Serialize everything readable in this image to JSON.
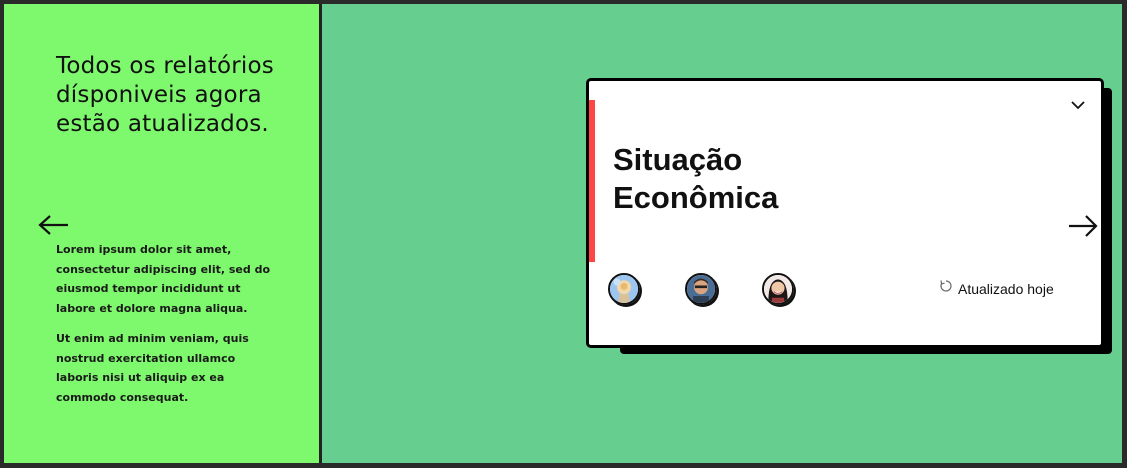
{
  "left": {
    "headline": "Todos os relatórios dísponiveis agora estão atualizados.",
    "paragraphs": [
      "Lorem ipsum dolor sit amet, consectetur adipiscing elit, sed do eiusmod tempor incididunt ut labore et dolore magna aliqua.",
      "Ut enim ad minim veniam, quis nostrud exercitation ullamco laboris nisi ut aliquip ex ea commodo consequat."
    ]
  },
  "card": {
    "title": "Situação Econômica",
    "status": "Atualizado hoje",
    "accent_color": "#ff4545"
  },
  "colors": {
    "left_panel": "#7ef86c",
    "right_panel": "#66ce8e"
  },
  "icons": {
    "back": "arrow-left-icon",
    "next": "arrow-right-icon",
    "expand": "chevron-down-icon",
    "status": "refresh-icon"
  }
}
